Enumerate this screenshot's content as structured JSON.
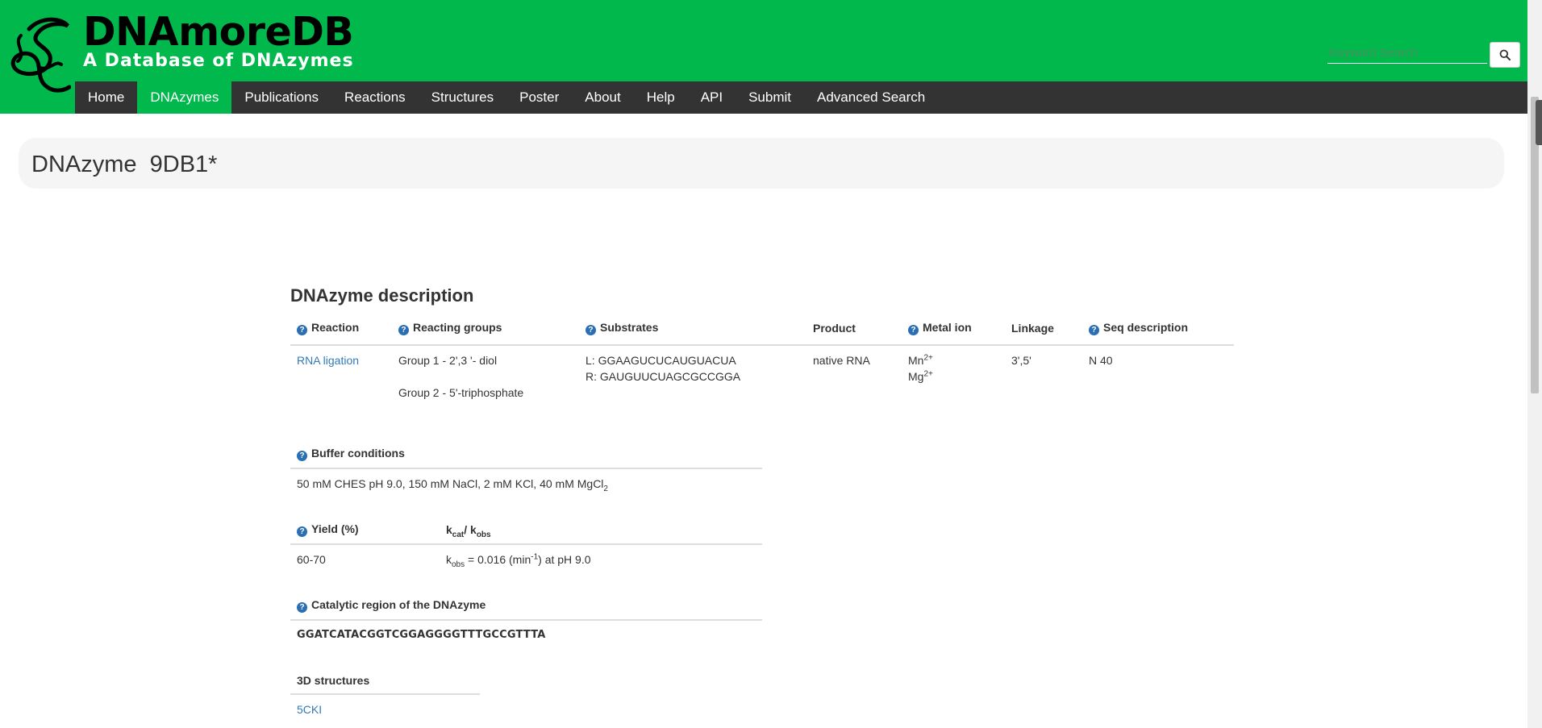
{
  "header": {
    "brand_title": "DNAmoreDB",
    "brand_subtitle": "A Database of DNAzymes",
    "logo_icon": "dnazyme-logo-icon",
    "search_placeholder": "Keyword Search",
    "search_icon": "search-icon",
    "colors": {
      "brand_green": "#00b84c",
      "nav_dark": "#333333",
      "link_blue": "#337ab7"
    }
  },
  "nav": {
    "items": [
      "Home",
      "DNAzymes",
      "Publications",
      "Reactions",
      "Structures",
      "Poster",
      "About",
      "Help",
      "API",
      "Submit",
      "Advanced Search"
    ],
    "active": "DNAzymes"
  },
  "page": {
    "title": "DNAzyme  9DB1*",
    "section_heading": "DNAzyme description"
  },
  "description_table": {
    "headers": {
      "reaction": "Reaction",
      "reacting_groups": "Reacting groups",
      "substrates": "Substrates",
      "product": "Product",
      "metal_ion": "Metal ion",
      "linkage": "Linkage",
      "seq_description": "Seq description"
    },
    "row": {
      "reaction": "RNA ligation",
      "reacting_group_1": "Group 1 - 2',3 '- diol",
      "reacting_group_2": "Group 2 - 5'-triphosphate",
      "substrate_l": "L: GGAAGUCUCAUGUACUA",
      "substrate_r": "R: GAUGUUCUAGCGCCGGA",
      "product": "native RNA",
      "metal_1": "Mn",
      "metal_1_charge": "2+",
      "metal_2": "Mg",
      "metal_2_charge": "2+",
      "linkage": "3',5'",
      "seq_description": "N 40"
    }
  },
  "buffer": {
    "header": "Buffer conditions",
    "value": "50 mM CHES pH 9.0, 150 mM NaCl, 2 mM KCl, 40 mM MgCl",
    "value_sub": "2"
  },
  "yield": {
    "header_yield": "Yield (%)",
    "header_k": "k",
    "header_k_sub1": "cat",
    "header_k_sep": "/ k",
    "header_k_sub2": "obs",
    "yield_value": "60-70",
    "k_prefix": "k",
    "k_prefix_sub": "obs",
    "k_value": " = 0.016 (min",
    "k_exp": "-1",
    "k_suffix": ") at pH 9.0"
  },
  "catalytic": {
    "header": "Catalytic region of the DNAzyme",
    "sequence": "GGATCATACGGTCGGAGGGGTTTGCCGTTTA"
  },
  "structures": {
    "header": "3D structures",
    "items": [
      "5CKI"
    ]
  }
}
